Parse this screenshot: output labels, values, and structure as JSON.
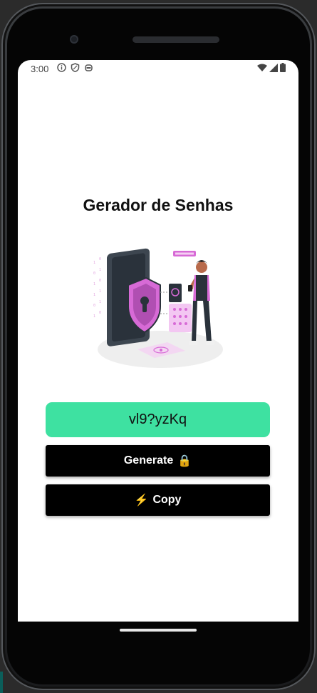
{
  "status_bar": {
    "time": "3:00",
    "left_icons": [
      "info-icon",
      "shield-icon",
      "android-icon"
    ],
    "right_icons": [
      "wifi-icon",
      "signal-icon",
      "battery-icon"
    ]
  },
  "app": {
    "title": "Gerador de Senhas",
    "password_value": "vl9?yzKq",
    "generate_label": "Generate",
    "generate_emoji": "🔒",
    "copy_emoji": "⚡",
    "copy_label": "Copy"
  },
  "colors": {
    "password_box": "#3ee1a1",
    "button_bg": "#000000",
    "button_text": "#ffffff",
    "accent_pink": "#d76ad6"
  }
}
